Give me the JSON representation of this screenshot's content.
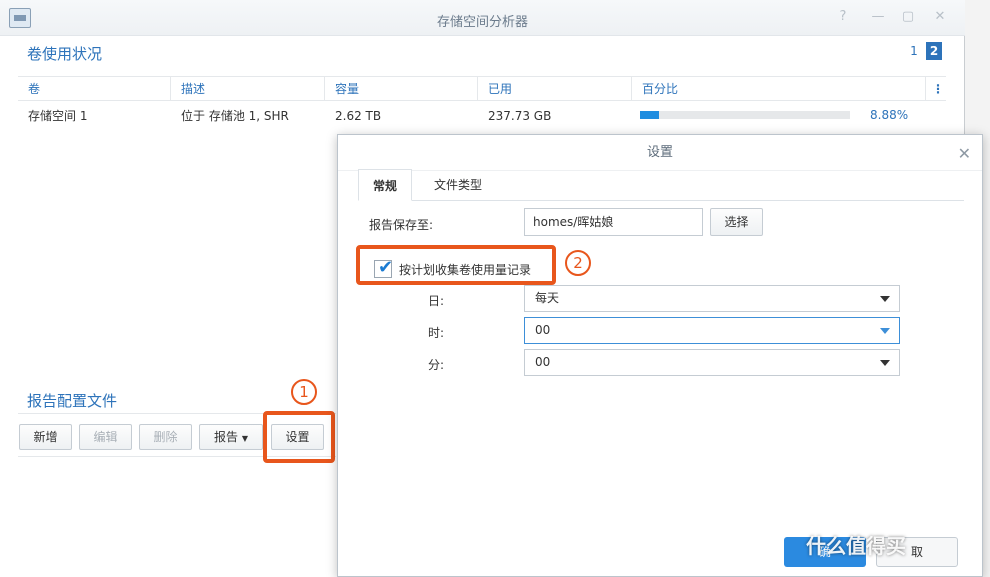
{
  "window": {
    "title": "存储空间分析器"
  },
  "volume_section": {
    "title": "卷使用状况",
    "pages": [
      "1",
      "2"
    ]
  },
  "table": {
    "headers": [
      "卷",
      "描述",
      "容量",
      "已用",
      "百分比"
    ],
    "rows": [
      {
        "volume": "存储空间 1",
        "description": "位于 存储池 1, SHR",
        "capacity": "2.62 TB",
        "used": "237.73 GB",
        "percent": "8.88%",
        "percent_value": 0.0888
      }
    ]
  },
  "report_section": {
    "title": "报告配置文件"
  },
  "toolbar": {
    "new": "新增",
    "edit": "编辑",
    "delete": "删除",
    "report": "报告",
    "settings": "设置"
  },
  "dialog": {
    "title": "设置",
    "tabs": [
      "常规",
      "文件类型"
    ],
    "save_to_label": "报告保存至:",
    "save_to_value": "homes/晖姑娘",
    "choose_button": "选择",
    "schedule_checkbox_label": "按计划收集卷使用量记录",
    "day_label": "日:",
    "day_value": "每天",
    "hour_label": "时:",
    "hour_value": "00",
    "minute_label": "分:",
    "minute_value": "00",
    "confirm_button": "确",
    "cancel_button": "取"
  },
  "annotations": {
    "step1": "1",
    "step2": "2"
  },
  "watermark": "什么值得买",
  "colors": {
    "accent": "#2d73ba",
    "annotation": "#e8561c",
    "progress": "#1f8de0"
  }
}
